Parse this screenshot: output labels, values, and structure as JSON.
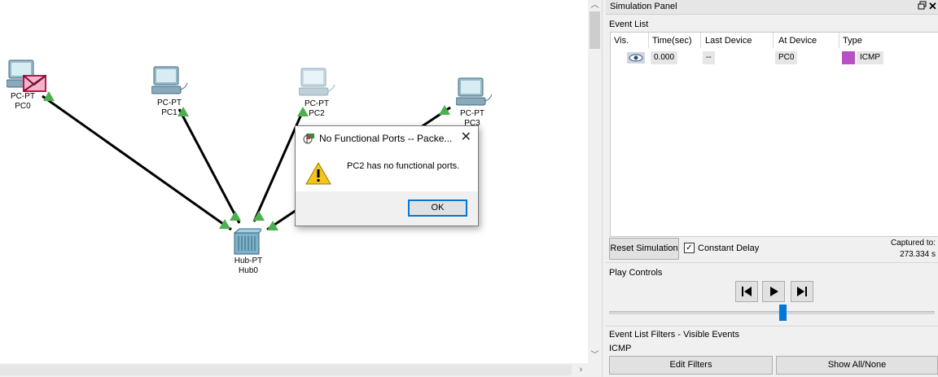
{
  "workspace": {
    "devices": [
      {
        "type": "PC-PT",
        "name": "PC0"
      },
      {
        "type": "PC-PT",
        "name": "PC1"
      },
      {
        "type": "PC-PT",
        "name": "PC2"
      },
      {
        "type": "PC-PT",
        "name": "PC3"
      },
      {
        "type": "Hub-PT",
        "name": "Hub0"
      }
    ],
    "link_color": "#000000",
    "port_status_color": "#4caf50",
    "pdu_icon": "envelope-icon"
  },
  "dialog": {
    "title": "No Functional Ports -- Packe...",
    "message": "PC2 has no functional ports.",
    "ok_label": "OK",
    "icon": "warning-icon",
    "close_glyph": "✕"
  },
  "panel": {
    "title": "Simulation Panel",
    "event_list_label": "Event List",
    "columns": [
      "Vis.",
      "Time(sec)",
      "Last Device",
      "At Device",
      "Type"
    ],
    "events": [
      {
        "visible_icon": "eye-icon",
        "time": "0.000",
        "last_device": "--",
        "at_device": "PC0",
        "type": "ICMP",
        "type_color": "#b84fc2"
      }
    ],
    "reset_label": "Reset Simulation",
    "constant_delay_label": "Constant Delay",
    "constant_delay_checked": true,
    "captured_label": "Captured to:",
    "captured_value": "273.334 s",
    "play_controls_label": "Play Controls",
    "playback_position": 0.54,
    "filters_label": "Event List Filters - Visible Events",
    "filters_value": "ICMP",
    "edit_filters_label": "Edit Filters",
    "show_all_label": "Show All/None"
  }
}
